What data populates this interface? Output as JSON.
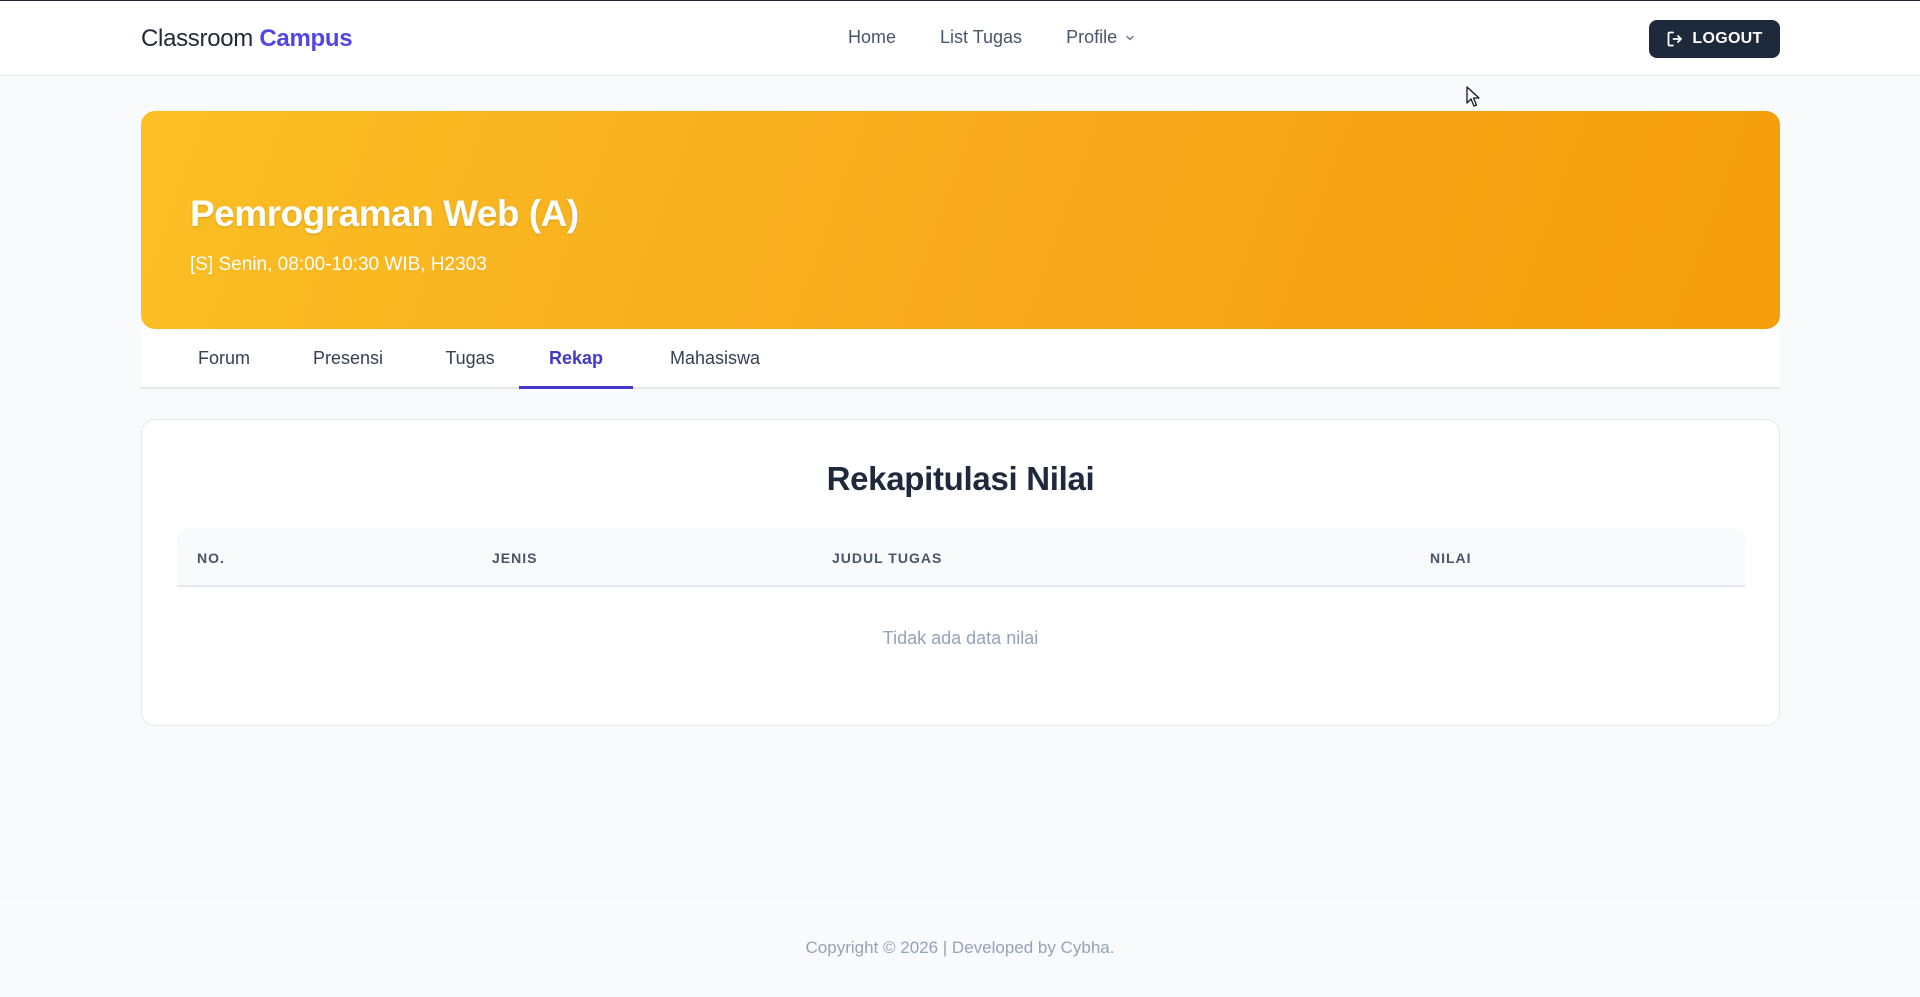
{
  "navbar": {
    "brand_main": "Classroom",
    "brand_accent": "Campus",
    "links": {
      "home": "Home",
      "list_tugas": "List Tugas",
      "profile": "Profile"
    },
    "logout_label": "LOGOUT"
  },
  "banner": {
    "title": "Pemrograman Web (A)",
    "schedule": "[S] Senin, 08:00-10:30 WIB, H2303",
    "gradient_colors": [
      "#fbbf24",
      "#f59e0b"
    ]
  },
  "tabs": {
    "items": [
      "Forum",
      "Presensi",
      "Tugas",
      "Rekap",
      "Mahasiswa"
    ],
    "active": "Rekap"
  },
  "rekap": {
    "title": "Rekapitulasi Nilai",
    "columns": [
      "NO.",
      "JENIS",
      "JUDUL TUGAS",
      "NILAI"
    ],
    "rows": [],
    "empty_text": "Tidak ada data nilai"
  },
  "footer": {
    "text": "Copyright © 2026 | Developed by Cybha."
  },
  "colors": {
    "accent": "#4f46e5",
    "logout_bg": "#1e293b",
    "banner": "#f7a81b"
  },
  "icons": {
    "logout": "logout-icon",
    "profile_dropdown": "chevron-down-icon"
  }
}
